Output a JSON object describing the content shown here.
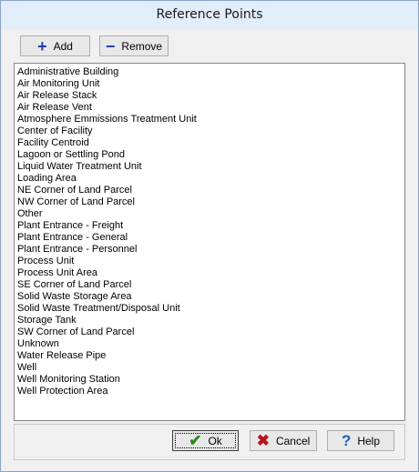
{
  "window": {
    "title": "Reference Points"
  },
  "toolbar": {
    "add_label": "Add",
    "add_icon": "plus-icon",
    "remove_label": "Remove",
    "remove_icon": "minus-icon"
  },
  "list": {
    "items": [
      "Administrative Building",
      "Air Monitoring Unit",
      "Air Release Stack",
      "Air Release Vent",
      "Atmosphere Emmissions Treatment Unit",
      "Center of Facility",
      "Facility Centroid",
      "Lagoon or Settling Pond",
      "Liquid Water Treatment Unit",
      "Loading Area",
      "NE Corner of Land Parcel",
      "NW Corner of Land Parcel",
      "Other",
      "Plant Entrance - Freight",
      "Plant Entrance - General",
      "Plant Entrance - Personnel",
      "Process Unit",
      "Process Unit Area",
      "SE Corner of Land Parcel",
      "Solid Waste Storage Area",
      "Solid Waste Treatment/Disposal Unit",
      "Storage Tank",
      "SW Corner of Land Parcel",
      "Unknown",
      "Water Release Pipe",
      "Well",
      "Well Monitoring Station",
      "Well Protection Area"
    ]
  },
  "footer": {
    "ok_label": "Ok",
    "ok_icon": "checkmark-icon",
    "cancel_label": "Cancel",
    "cancel_icon": "x-icon",
    "help_label": "Help",
    "help_icon": "question-mark-icon"
  }
}
